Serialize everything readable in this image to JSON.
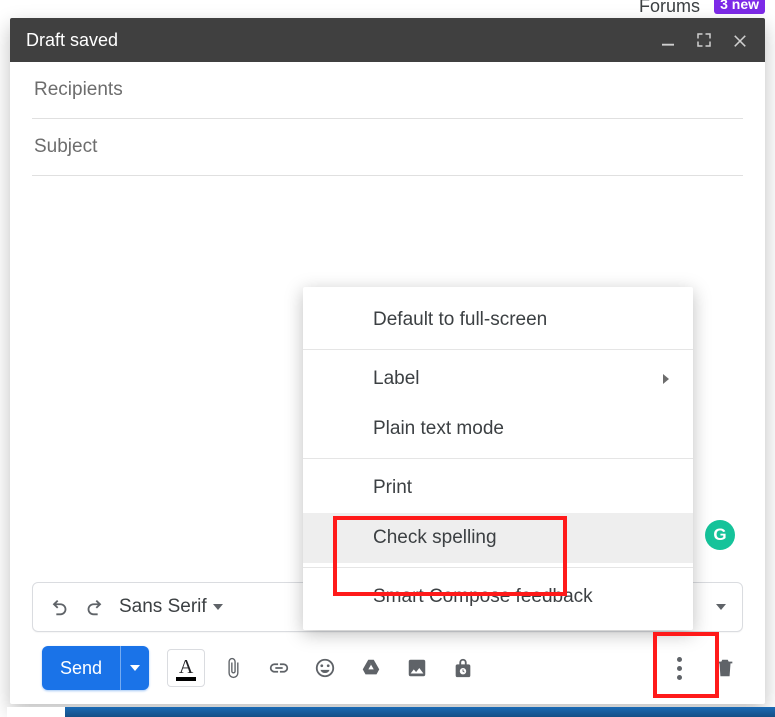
{
  "background": {
    "forums_label": "Forums",
    "badge_text": "3 new"
  },
  "compose": {
    "title": "Draft saved",
    "recipients_placeholder": "Recipients",
    "recipients_value": "",
    "subject_placeholder": "Subject",
    "subject_value": "",
    "body_value": ""
  },
  "format_bar": {
    "font_family": "Sans Serif"
  },
  "actions": {
    "send_label": "Send",
    "text_color_letter": "A"
  },
  "menu": {
    "items": [
      {
        "label": "Default to full-screen",
        "has_submenu": false
      },
      {
        "label": "Label",
        "has_submenu": true
      },
      {
        "label": "Plain text mode",
        "has_submenu": false
      },
      {
        "label": "Print",
        "has_submenu": false
      },
      {
        "label": "Check spelling",
        "has_submenu": false,
        "hover": true
      },
      {
        "label": "Smart Compose feedback",
        "has_submenu": false
      }
    ]
  },
  "grammarly": {
    "letter": "G"
  },
  "colors": {
    "accent": "#1a73e8",
    "header": "#404040",
    "highlight": "#ff1a1a",
    "grammarly": "#15c39a"
  }
}
